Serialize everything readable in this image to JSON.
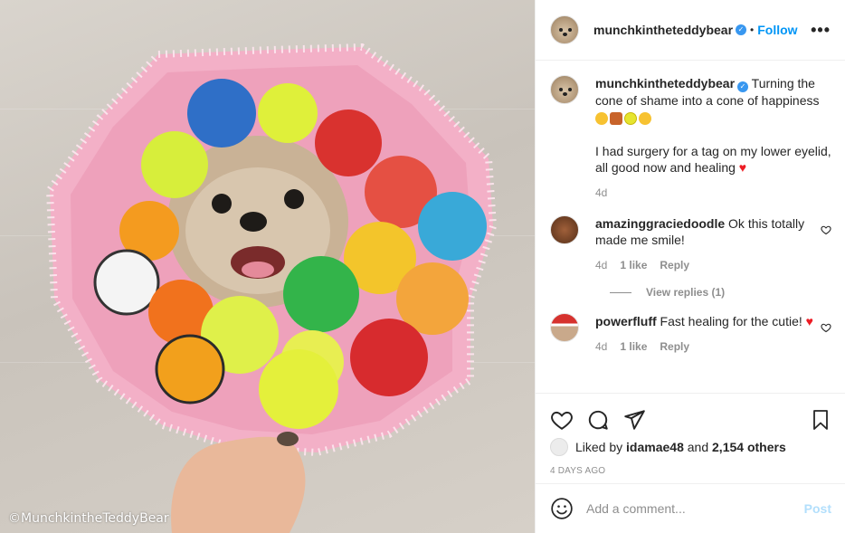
{
  "photo": {
    "credit": "©MunchkintheTeddyBear"
  },
  "header": {
    "username": "munchkintheteddybear",
    "separator": "•",
    "follow_label": "Follow",
    "more_label": "•••"
  },
  "caption": {
    "username": "munchkintheteddybear",
    "line1": "Turning the cone of shame into a cone of happiness",
    "line2": "I had surgery for a tag on my lower eyelid, all good now and healing",
    "time": "4d"
  },
  "comments": [
    {
      "username": "amazinggraciedoodle",
      "text": "Ok this totally made me smile!",
      "time": "4d",
      "likes": "1 like",
      "reply_label": "Reply",
      "view_replies": "View replies (1)"
    },
    {
      "username": "powerfluff",
      "text": "Fast healing for the cutie!",
      "time": "4d",
      "likes": "1 like",
      "reply_label": "Reply"
    }
  ],
  "likes": {
    "prefix": "Liked by",
    "user": "idamae48",
    "and": "and",
    "others": "2,154 others"
  },
  "timestamp": "4 DAYS AGO",
  "add_comment": {
    "placeholder": "Add a comment...",
    "post_label": "Post"
  },
  "colors": {
    "link_blue": "#0095f6",
    "post_disabled": "#b2dffc",
    "heart_red": "#ed1c24",
    "verified_blue": "#3897f0",
    "cone_pink": "#f2a9c3"
  }
}
